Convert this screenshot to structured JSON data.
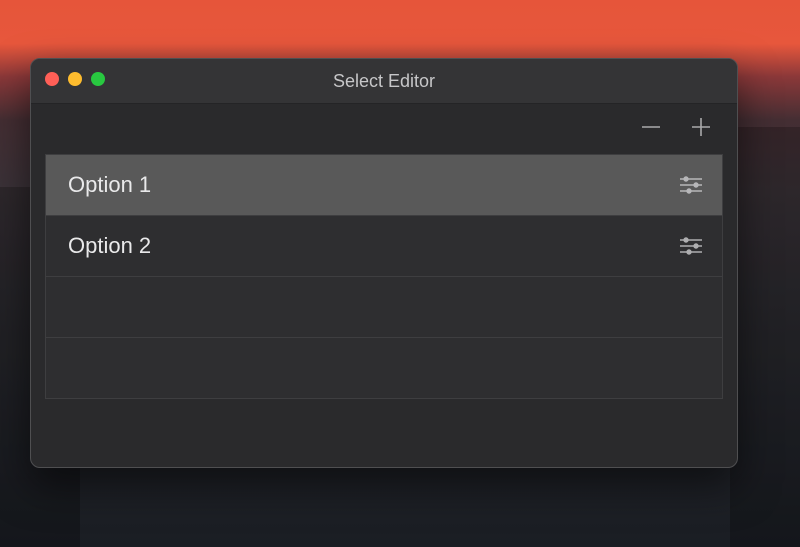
{
  "window": {
    "title": "Select Editor"
  },
  "toolbar": {
    "remove_tooltip": "Remove",
    "add_tooltip": "Add"
  },
  "rows": [
    {
      "label": "Option 1",
      "selected": true,
      "has_settings": true
    },
    {
      "label": "Option 2",
      "selected": false,
      "has_settings": true
    },
    {
      "label": "",
      "selected": false,
      "has_settings": false
    },
    {
      "label": "",
      "selected": false,
      "has_settings": false
    }
  ]
}
